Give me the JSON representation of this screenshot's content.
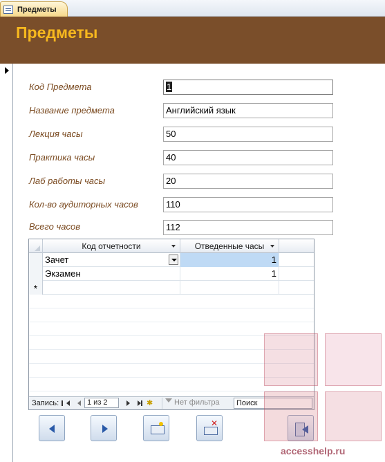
{
  "tab": {
    "label": "Предметы"
  },
  "header": {
    "title": "Предметы"
  },
  "fields": [
    {
      "label": "Код Предмета",
      "value": "1"
    },
    {
      "label": "Название предмета",
      "value": "Английский язык"
    },
    {
      "label": "Лекция часы",
      "value": "50"
    },
    {
      "label": "Практика часы",
      "value": "40"
    },
    {
      "label": "Лаб работы часы",
      "value": "20"
    },
    {
      "label": "Кол-во аудиторных часов",
      "value": "110"
    },
    {
      "label": "Всего часов",
      "value": "112"
    }
  ],
  "subform": {
    "columns": [
      "Код отчетности",
      "Отведенные часы"
    ],
    "rows": [
      {
        "code": "Зачет",
        "hours": "1"
      },
      {
        "code": "Экзамен",
        "hours": "1"
      }
    ],
    "new_row_marker": "*",
    "navigation": {
      "record_label": "Запись:",
      "position": "1 из 2",
      "filter": "Нет фильтра",
      "search": "Поиск"
    }
  },
  "watermark": {
    "text": "accesshelp.ru"
  },
  "icons": [
    "form-icon",
    "record-selector-icon",
    "dropdown-arrow-icon",
    "filter-icon",
    "prev-record-icon",
    "next-record-icon",
    "new-record-icon",
    "delete-record-icon",
    "close-form-icon"
  ]
}
